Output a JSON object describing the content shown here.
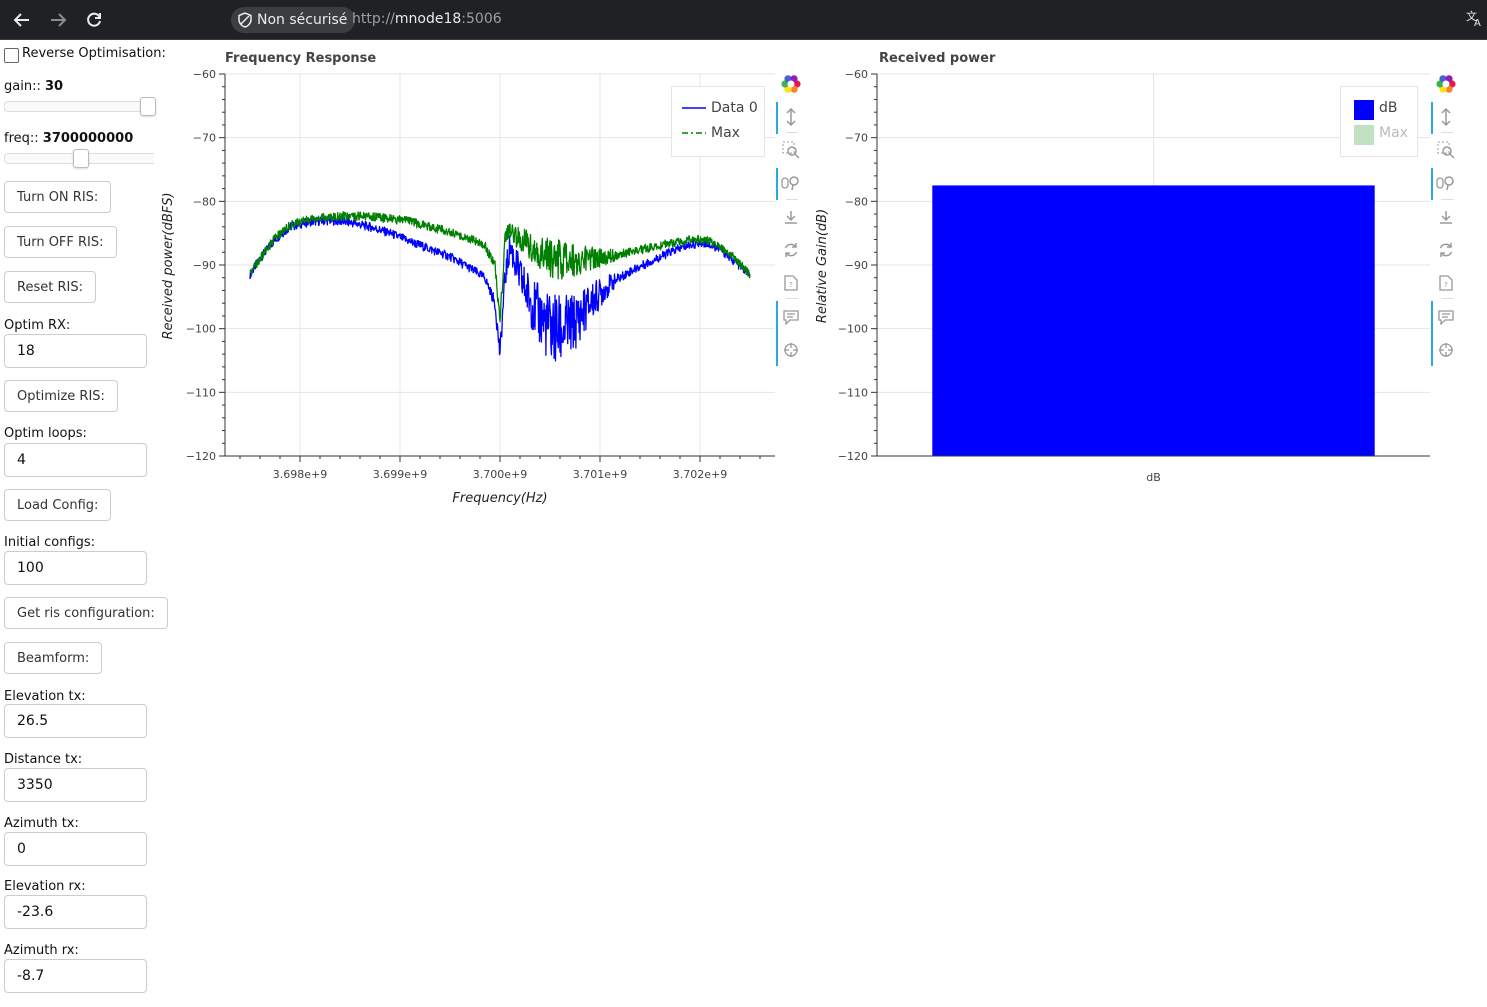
{
  "browser": {
    "security_label": "Non sécurisé",
    "url_scheme": "http://",
    "url_host": "mnode18",
    "url_port": ":5006"
  },
  "controls": {
    "reverse_optimisation_label": "Reverse Optimisation:",
    "reverse_optimisation_checked": false,
    "gain_label": "gain:: ",
    "gain_value": "30",
    "gain_slider": {
      "min": 0,
      "max": 30,
      "value": 30
    },
    "freq_label": "freq:: ",
    "freq_value": "3700000000",
    "freq_slider_fraction": 0.5,
    "turn_on_label": "Turn ON RIS:",
    "turn_off_label": "Turn OFF RIS:",
    "reset_label": "Reset RIS:",
    "optim_rx_label": "Optim RX:",
    "optim_rx_value": "18",
    "optimize_label": "Optimize RIS:",
    "optim_loops_label": "Optim loops:",
    "optim_loops_value": "4",
    "load_config_label": "Load Config:",
    "initial_configs_label": "Initial configs:",
    "initial_configs_value": "100",
    "get_config_label": "Get ris configuration:",
    "beamform_label": "Beamform:",
    "elevation_tx_label": "Elevation tx:",
    "elevation_tx_value": "26.5",
    "distance_tx_label": "Distance tx:",
    "distance_tx_value": "3350",
    "azimuth_tx_label": "Azimuth tx:",
    "azimuth_tx_value": "0",
    "elevation_rx_label": "Elevation rx:",
    "elevation_rx_value": "-23.6",
    "azimuth_rx_label": "Azimuth rx:",
    "azimuth_rx_value": "-8.7"
  },
  "chart_data": [
    {
      "type": "line",
      "title": "Frequency Response",
      "xlabel": "Frequency(Hz)",
      "ylabel": "Received power(dBFS)",
      "xlim": [
        3697250000,
        3702750000
      ],
      "ylim": [
        -120,
        -60
      ],
      "xticks": [
        "3.698e+9",
        "3.699e+9",
        "3.700e+9",
        "3.701e+9",
        "3.702e+9"
      ],
      "yticks": [
        "−60",
        "−70",
        "−80",
        "−90",
        "−100",
        "−110",
        "−120"
      ],
      "grid": true,
      "legend_position": "top-right",
      "legend": [
        "Data 0",
        "Max"
      ],
      "series": [
        {
          "name": "Data 0",
          "color": "#0000ff",
          "x": [
            3697500000,
            3697600000,
            3697750000,
            3697900000,
            3698100000,
            3698300000,
            3698500000,
            3698700000,
            3698900000,
            3699100000,
            3699300000,
            3699500000,
            3699700000,
            3699850000,
            3699950000,
            3700000000,
            3700050000,
            3700100000,
            3700200000,
            3700350000,
            3700500000,
            3700600000,
            3700750000,
            3700900000,
            3701100000,
            3701300000,
            3701500000,
            3701700000,
            3701900000,
            3702050000,
            3702200000,
            3702350000,
            3702500000
          ],
          "y": [
            -91.5,
            -89,
            -86,
            -84,
            -83.2,
            -83,
            -83.3,
            -84,
            -85,
            -86.3,
            -87.5,
            -88.7,
            -90.5,
            -92,
            -96,
            -104,
            -92,
            -87,
            -92,
            -97,
            -100,
            -100.5,
            -99,
            -96,
            -93,
            -91,
            -89.5,
            -88,
            -86.8,
            -86.5,
            -87.5,
            -89.5,
            -91.5
          ]
        },
        {
          "name": "Max",
          "color": "#008000",
          "x": [
            3697500000,
            3697600000,
            3697750000,
            3697900000,
            3698100000,
            3698300000,
            3698500000,
            3698700000,
            3698900000,
            3699100000,
            3699300000,
            3699500000,
            3699700000,
            3699850000,
            3699950000,
            3700000000,
            3700050000,
            3700100000,
            3700200000,
            3700350000,
            3700500000,
            3700600000,
            3700750000,
            3700900000,
            3701100000,
            3701300000,
            3701500000,
            3701700000,
            3701900000,
            3702050000,
            3702200000,
            3702350000,
            3702500000
          ],
          "y": [
            -91.5,
            -89,
            -85.8,
            -83.8,
            -82.8,
            -82.4,
            -82.3,
            -82.4,
            -82.7,
            -83.2,
            -84,
            -84.8,
            -85.8,
            -87,
            -90,
            -99,
            -86,
            -84.5,
            -86,
            -87.5,
            -88.8,
            -89.2,
            -89.3,
            -89,
            -88.6,
            -88,
            -87.3,
            -86.6,
            -86,
            -86,
            -87,
            -89,
            -91.5
          ]
        }
      ]
    },
    {
      "type": "bar",
      "title": "Received power",
      "ylabel": "Relative Gain(dB)",
      "categories": [
        "dB"
      ],
      "ylim": [
        -120,
        -60
      ],
      "yticks": [
        "−60",
        "−70",
        "−80",
        "−90",
        "−100",
        "−110",
        "−120"
      ],
      "grid": true,
      "legend_position": "top-right",
      "legend": [
        "dB",
        "Max"
      ],
      "series": [
        {
          "name": "dB",
          "color": "#0000ff",
          "values": [
            -77.5
          ]
        },
        {
          "name": "Max",
          "color": "#c2e0c2",
          "values": []
        }
      ]
    }
  ],
  "toolbar_icons": [
    "bokeh-logo-icon",
    "pan-icon",
    "box-zoom-icon",
    "wheel-zoom-icon",
    "save-icon",
    "reset-icon",
    "help-icon",
    "hover-icon",
    "crosshair-icon"
  ]
}
